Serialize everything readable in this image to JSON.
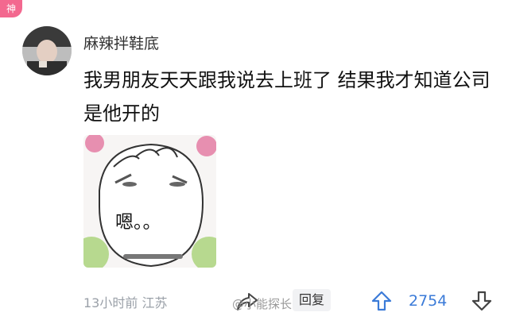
{
  "badge": {
    "label": "神"
  },
  "comment": {
    "username": "麻辣拌鞋底",
    "text": "我男朋友天天跟我说去上班了 结果我才知道公司是他开的",
    "meme_caption": "嗯。。",
    "meta": "13小时前 江苏",
    "reply_label": "回复",
    "like_count": "2754"
  },
  "watermark": {
    "text": "@小能探长"
  },
  "colors": {
    "badge": "#f3688f",
    "accent": "#3b7bd8",
    "meta": "#9aa0a8"
  },
  "icons": [
    "share-icon",
    "arrow-up-icon",
    "arrow-down-icon"
  ]
}
